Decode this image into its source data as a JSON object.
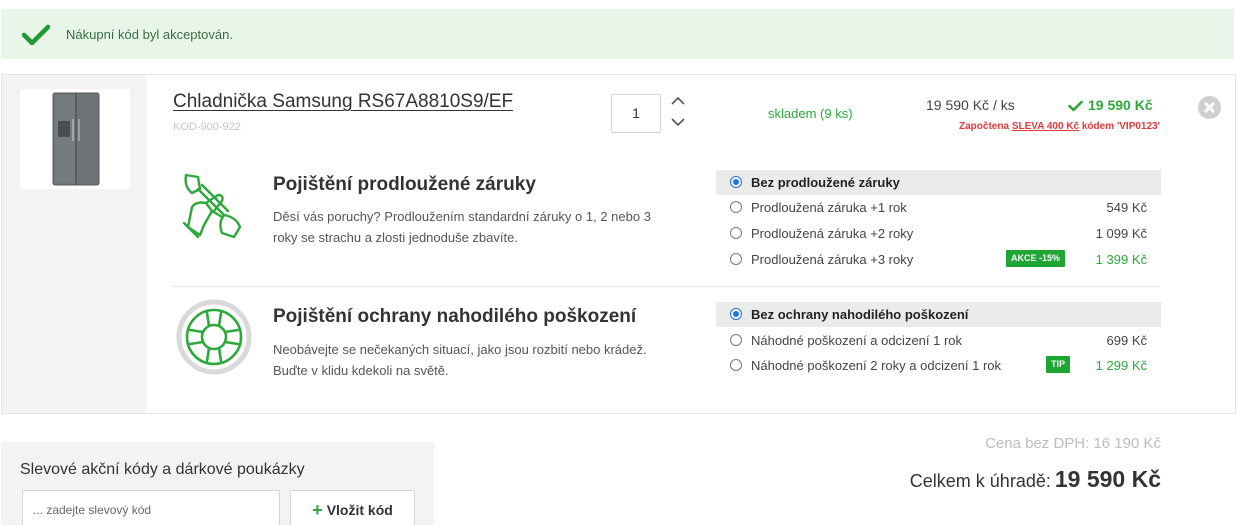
{
  "alert": {
    "message": "Nákupní kód byl akceptován.",
    "icon": "check-icon"
  },
  "item": {
    "name": "Chladnička Samsung RS67A8810S9/EF",
    "code": "KOD-900-922",
    "quantity": "1",
    "stock": "skladem (9 ks)",
    "unit_price": "19 590 Kč / ks",
    "total": "19 590 Kč",
    "discount": {
      "prefix": "Započtena",
      "link": "SLEVA 400 Kč",
      "suffix": "kódem 'VIP0123'"
    }
  },
  "warranty": {
    "title": "Pojištění prodloužené záruky",
    "description": "Děsí vás poruchy? Prodloužením standardní záruky o 1, 2 nebo 3 roky se strachu a zlosti jednoduše zbavíte.",
    "options": [
      {
        "label": "Bez prodloužené záruky",
        "price": "",
        "selected": true
      },
      {
        "label": "Prodloužená záruka +1 rok",
        "price": "549 Kč",
        "selected": false
      },
      {
        "label": "Prodloužená záruka +2 roky",
        "price": "1 099 Kč",
        "selected": false
      },
      {
        "label": "Prodloužená záruka +3 roky",
        "price": "1 399 Kč",
        "selected": false,
        "badge": "AKCE -15%"
      }
    ]
  },
  "damage": {
    "title": "Pojištění ochrany nahodilého poškození",
    "description": "Neobávejte se nečekaných situací, jako jsou rozbití nebo krádež. Buďte v klidu kdekoli na světě.",
    "options": [
      {
        "label": "Bez ochrany nahodilého poškození",
        "price": "",
        "selected": true
      },
      {
        "label": "Náhodné poškození a odcizení 1 rok",
        "price": "699 Kč",
        "selected": false
      },
      {
        "label": "Náhodné poškození 2 roky a odcizení 1 rok",
        "price": "1 299 Kč",
        "selected": false,
        "badge": "TIP"
      }
    ]
  },
  "voucher": {
    "title": "Slevové akční kódy a dárkové poukázky",
    "placeholder": "... zadejte slevový kód",
    "button": "Vložit kód"
  },
  "summary": {
    "net_label": "Cena bez DPH: 16 190 Kč",
    "grand_label": "Celkem k úhradě:",
    "grand_value": "19 590 Kč"
  },
  "colors": {
    "accent": "#2da83b",
    "danger": "#e03a3e",
    "banner": "#e8f6ea",
    "radio": "#1a73e8"
  }
}
